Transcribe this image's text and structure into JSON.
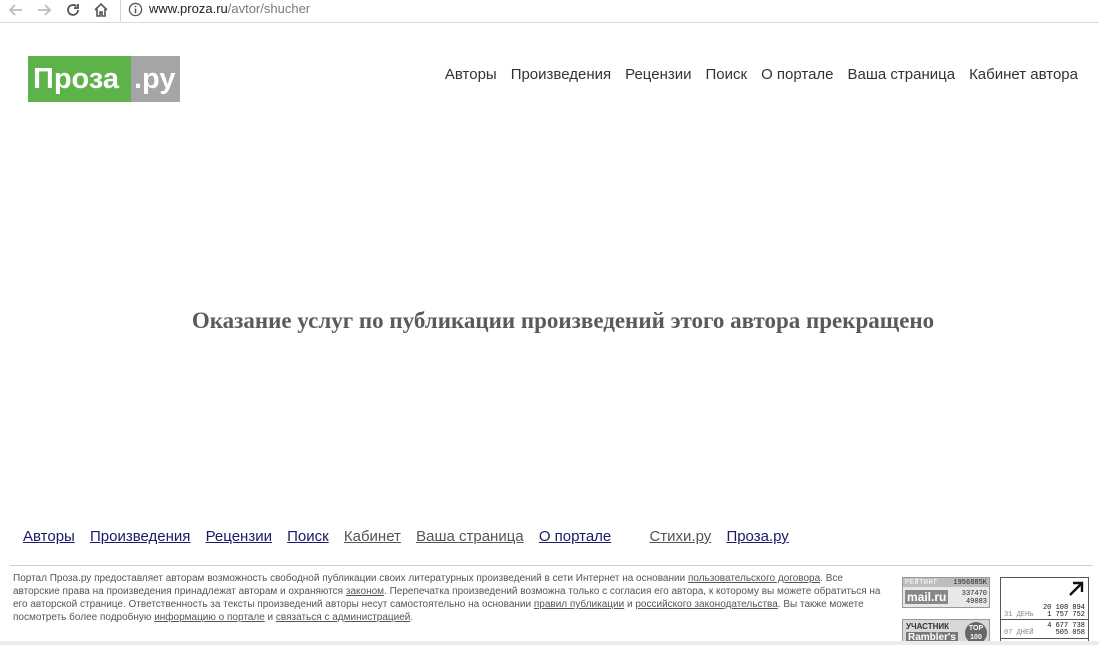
{
  "browser": {
    "url_host": "www.proza.ru",
    "url_path": "/avtor/shucher"
  },
  "logo": {
    "part1": "Проза",
    "part2": ".ру"
  },
  "top_nav": [
    "Авторы",
    "Произведения",
    "Рецензии",
    "Поиск",
    "О портале",
    "Ваша страница",
    "Кабинет автора"
  ],
  "notice": "Оказание услуг по публикации произведений этого автора прекращено",
  "bottom_nav": {
    "authors": "Авторы",
    "works": "Произведения",
    "reviews": "Рецензии",
    "search": "Поиск",
    "cabinet": "Кабинет",
    "your_page": "Ваша страница",
    "about": "О портале",
    "stihi": "Стихи.ру",
    "proza": "Проза.ру"
  },
  "footer": {
    "t1": "Портал Проза.ру предоставляет авторам возможность свободной публикации своих литературных произведений в сети Интернет на основании ",
    "l1": "пользовательского договора",
    "t2": ". Все авторские права на произведения принадлежат авторам и охраняются ",
    "l2": "законом",
    "t3": ". Перепечатка произведений возможна только с согласия его автора, к которому вы можете обратиться на его авторской странице. Ответственность за тексты произведений авторы несут самостоятельно на основании ",
    "l3": "правил публикации",
    "t4": " и ",
    "l4": "российского законодательства",
    "t5": ". Вы также можете посмотреть более подробную ",
    "l5": "информацию о портале",
    "t6": " и ",
    "l6": "связаться с администрацией",
    "t7": "."
  },
  "counters": {
    "mail": {
      "label": "РЕЙТИНГ",
      "value1": "1956885K",
      "logo": "mail.ru",
      "value2": "337470",
      "value3": "49083"
    },
    "rambler": {
      "label": "УЧАСТНИК",
      "logo": "Rambler's",
      "badge_top": "TOP",
      "badge_num": "100"
    },
    "liveinternet": {
      "row1_top": "20 108 894",
      "row1_bottom": "1 757 752",
      "row1_label": "31 ДЕНЬ",
      "row2_top": "4 677 738",
      "row2_bottom": "505 058",
      "row2_label": "07 ДНЕЙ"
    }
  }
}
